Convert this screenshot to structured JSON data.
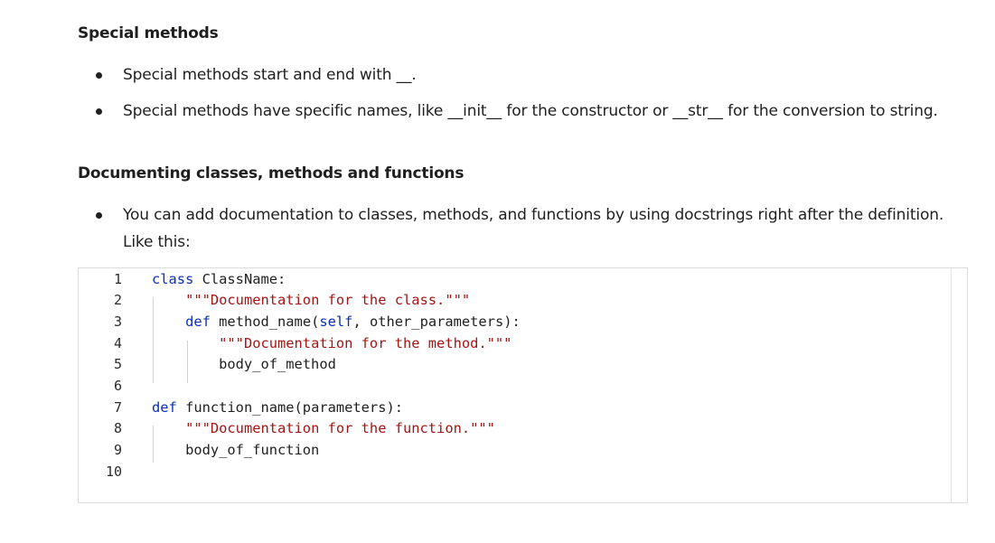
{
  "sections": [
    {
      "heading": "Special methods",
      "bullets": [
        "Special methods start and end with __.",
        "Special methods have specific names, like __init__ for the constructor or __str__ for the conversion to string."
      ]
    },
    {
      "heading": "Documenting classes, methods and functions",
      "bullets": [
        "You can add documentation to classes, methods, and functions by using docstrings right after the definition. Like this:"
      ]
    }
  ],
  "code": {
    "line_numbers": [
      "1",
      "2",
      "3",
      "4",
      "5",
      "6",
      "7",
      "8",
      "9",
      "10"
    ],
    "lines": [
      [
        {
          "t": "kw",
          "v": "class"
        },
        {
          "t": "plain",
          "v": " ClassName:"
        }
      ],
      [
        {
          "t": "plain",
          "v": "    "
        },
        {
          "t": "str",
          "v": "\"\"\"Documentation for the class.\"\"\""
        }
      ],
      [
        {
          "t": "plain",
          "v": "    "
        },
        {
          "t": "kw",
          "v": "def"
        },
        {
          "t": "plain",
          "v": " method_name("
        },
        {
          "t": "self",
          "v": "self"
        },
        {
          "t": "plain",
          "v": ", other_parameters):"
        }
      ],
      [
        {
          "t": "plain",
          "v": "        "
        },
        {
          "t": "str",
          "v": "\"\"\"Documentation for the method.\"\"\""
        }
      ],
      [
        {
          "t": "plain",
          "v": "        body_of_method"
        }
      ],
      [
        {
          "t": "plain",
          "v": ""
        }
      ],
      [
        {
          "t": "kw",
          "v": "def"
        },
        {
          "t": "plain",
          "v": " function_name(parameters):"
        }
      ],
      [
        {
          "t": "plain",
          "v": "    "
        },
        {
          "t": "str",
          "v": "\"\"\"Documentation for the function.\"\"\""
        }
      ],
      [
        {
          "t": "plain",
          "v": "    body_of_function"
        }
      ],
      [
        {
          "t": "plain",
          "v": ""
        }
      ]
    ]
  }
}
